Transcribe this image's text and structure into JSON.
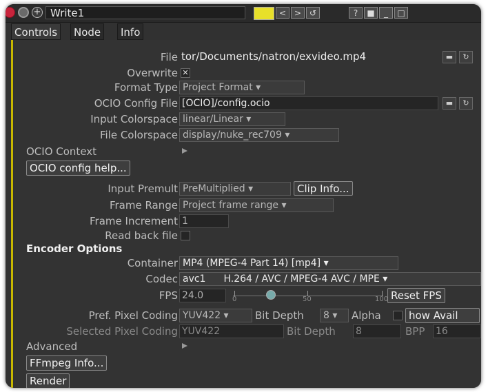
{
  "window": {
    "node_name": "Write1",
    "swatch_color": "#e8e02a"
  },
  "tabs": [
    {
      "label": "Controls"
    },
    {
      "label": "Node"
    },
    {
      "label": "Info"
    }
  ],
  "fields": {
    "file": {
      "label": "File",
      "value": "tor/Documents/natron/exvideo.mp4"
    },
    "overwrite": {
      "label": "Overwrite",
      "checked": true
    },
    "format_type": {
      "label": "Format Type",
      "value": "Project Format"
    },
    "ocio_config_file": {
      "label": "OCIO Config File",
      "value": "[OCIO]/config.ocio"
    },
    "input_colorspace": {
      "label": "Input Colorspace",
      "value": "linear/Linear"
    },
    "file_colorspace": {
      "label": "File Colorspace",
      "value": "display/nuke_rec709"
    },
    "ocio_context": {
      "label": "OCIO Context"
    },
    "ocio_help_button": "OCIO config help...",
    "input_premult": {
      "label": "Input Premult",
      "value": "PreMultiplied"
    },
    "clip_info_button": "Clip Info...",
    "frame_range": {
      "label": "Frame Range",
      "value": "Project frame range"
    },
    "frame_increment": {
      "label": "Frame Increment",
      "value": "1"
    },
    "read_back_file": {
      "label": "Read back file",
      "checked": false
    },
    "encoder_options": "Encoder Options",
    "container": {
      "label": "Container",
      "value": "MP4 (MPEG-4 Part 14) [mp4]"
    },
    "codec": {
      "label": "Codec",
      "short": "avc1",
      "value": "H.264 / AVC / MPEG-4 AVC / MPE"
    },
    "fps": {
      "label": "FPS",
      "value": "24.0",
      "tick_min": "0",
      "tick_mid": "50",
      "tick_max": "100",
      "reset_button": "Reset FPS"
    },
    "pref_pixel_coding": {
      "label": "Pref. Pixel Coding",
      "value": "YUV422",
      "bit_depth_label": "Bit Depth",
      "bit_depth_value": "8",
      "alpha_label": "Alpha",
      "show_avail_button": "how Avail"
    },
    "selected_pixel_coding": {
      "label": "Selected Pixel Coding",
      "value": "YUV422",
      "bit_depth_label": "Bit Depth",
      "bit_depth_value": "8",
      "bpp_label": "BPP",
      "bpp_value": "16"
    },
    "advanced": {
      "label": "Advanced"
    },
    "ffmpeg_info_button": "FFmpeg Info...",
    "render_button": "Render"
  }
}
